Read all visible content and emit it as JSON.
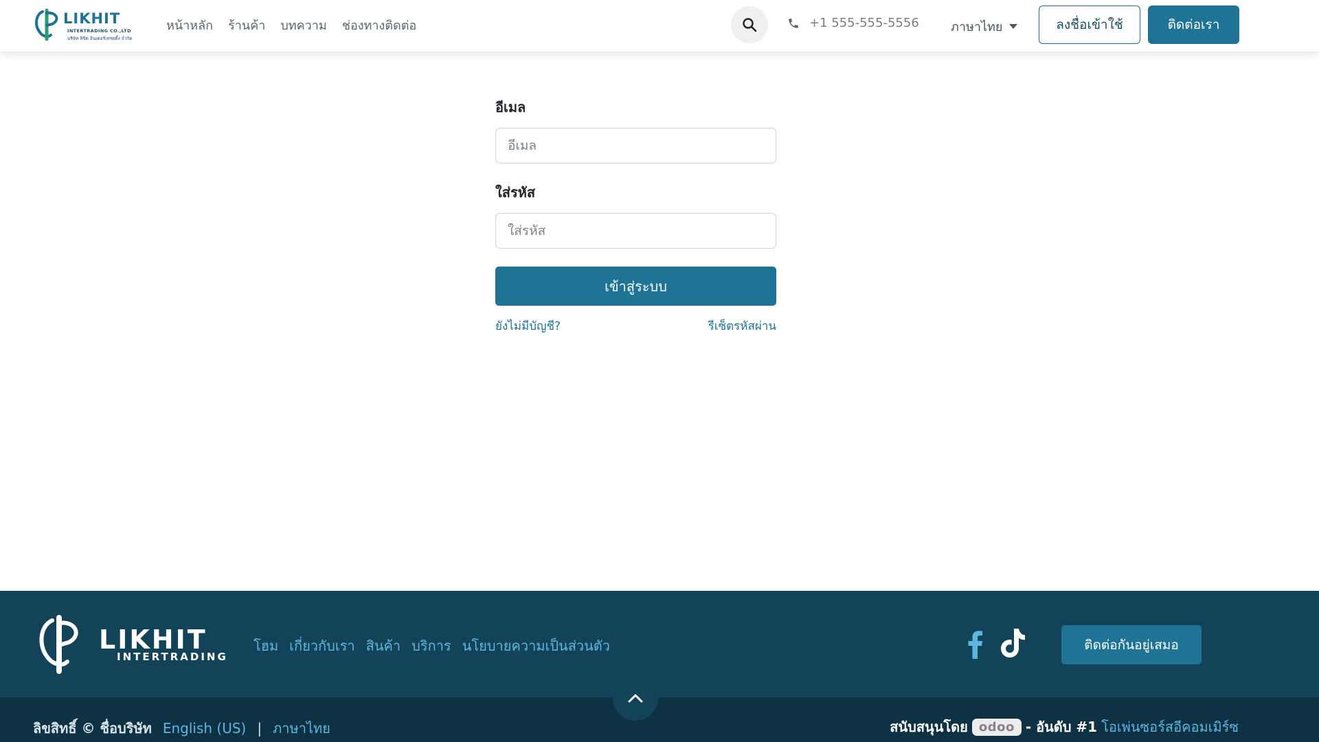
{
  "header": {
    "logo": {
      "word": "LIKHIT",
      "line1": "INTERTRADING CO.,LTD",
      "line2": "บริษัท ลิขิต อินเตอร์เทรดดิ้ง จำกัด"
    },
    "nav": [
      "หน้าหลัก",
      "ร้านค้า",
      "บทความ",
      "ช่องทางติดต่อ"
    ],
    "search_icon": "search-icon",
    "phone_icon": "phone-icon",
    "phone": "+1 555-555-5556",
    "language": "ภาษาไทย",
    "login_button": "ลงชื่อเข้าใช้",
    "contact_button": "ติดต่อเรา"
  },
  "login": {
    "email_label": "อีเมล",
    "email_placeholder": "อีเมล",
    "email_value": "",
    "password_label": "ใส่รหัส",
    "password_placeholder": "ใส่รหัส",
    "password_value": "",
    "submit": "เข้าสู่ระบบ",
    "no_account": "ยังไม่มีบัญชี?",
    "reset_password": "รีเซ็ตรหัสผ่าน"
  },
  "footer": {
    "logo": {
      "word": "LIKHIT",
      "sub": "INTERTRADING"
    },
    "nav": [
      "โฮม",
      "เกี่ยวกับเรา",
      "สินค้า",
      "บริการ",
      "นโยบายความเป็นส่วนตัว"
    ],
    "social": [
      "facebook-icon",
      "tiktok-icon"
    ],
    "contact_button": "ติดต่อกันอยู่เสมอ",
    "back_to_top_icon": "chevron-up-icon",
    "copyright": "ลิขสิทธิ์ © ชื่อบริษัท",
    "lang_en": "English (US)",
    "lang_sep": "|",
    "lang_th": "ภาษาไทย",
    "powered_by": "สนับสนุนโดย",
    "odoo": "odoo",
    "rank": "- อันดับ #1",
    "ecommerce": "โอเพ่นซอร์สอีคอมเมิร์ซ"
  },
  "colors": {
    "primary": "#1f7394",
    "footer_bg": "#134359",
    "footer_bottom_bg": "#0e3244",
    "link_light": "#5eb5e0"
  }
}
